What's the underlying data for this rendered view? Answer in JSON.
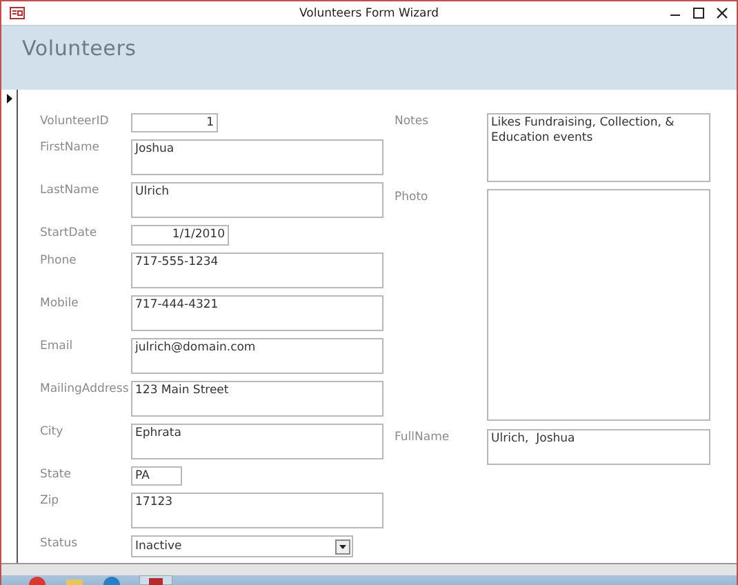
{
  "window": {
    "title": "Volunteers Form Wizard"
  },
  "form": {
    "title": "Volunteers",
    "current_record": true,
    "left_fields": [
      {
        "label": "VolunteerID",
        "value": "1",
        "kind": "number"
      },
      {
        "label": "FirstName",
        "value": "Joshua",
        "kind": "text"
      },
      {
        "label": "LastName",
        "value": "Ulrich",
        "kind": "text"
      },
      {
        "label": "StartDate",
        "value": "1/1/2010",
        "kind": "date"
      },
      {
        "label": "Phone",
        "value": "717-555-1234",
        "kind": "text"
      },
      {
        "label": "Mobile",
        "value": "717-444-4321",
        "kind": "text"
      },
      {
        "label": "Email",
        "value": "julrich@domain.com",
        "kind": "text"
      },
      {
        "label": "MailingAddress",
        "value": "123 Main Street",
        "kind": "text"
      },
      {
        "label": "City",
        "value": "Ephrata",
        "kind": "text"
      },
      {
        "label": "State",
        "value": "PA",
        "kind": "short"
      },
      {
        "label": "Zip",
        "value": "17123",
        "kind": "text"
      },
      {
        "label": "Status",
        "value": "Inactive",
        "kind": "combo"
      }
    ],
    "right_fields": [
      {
        "label": "Notes",
        "value": "Likes Fundraising, Collection, & Education events",
        "kind": "memo"
      },
      {
        "label": "Photo",
        "kind": "image"
      },
      {
        "label": "FullName",
        "value": "Ulrich,  Joshua",
        "kind": "text"
      }
    ]
  }
}
